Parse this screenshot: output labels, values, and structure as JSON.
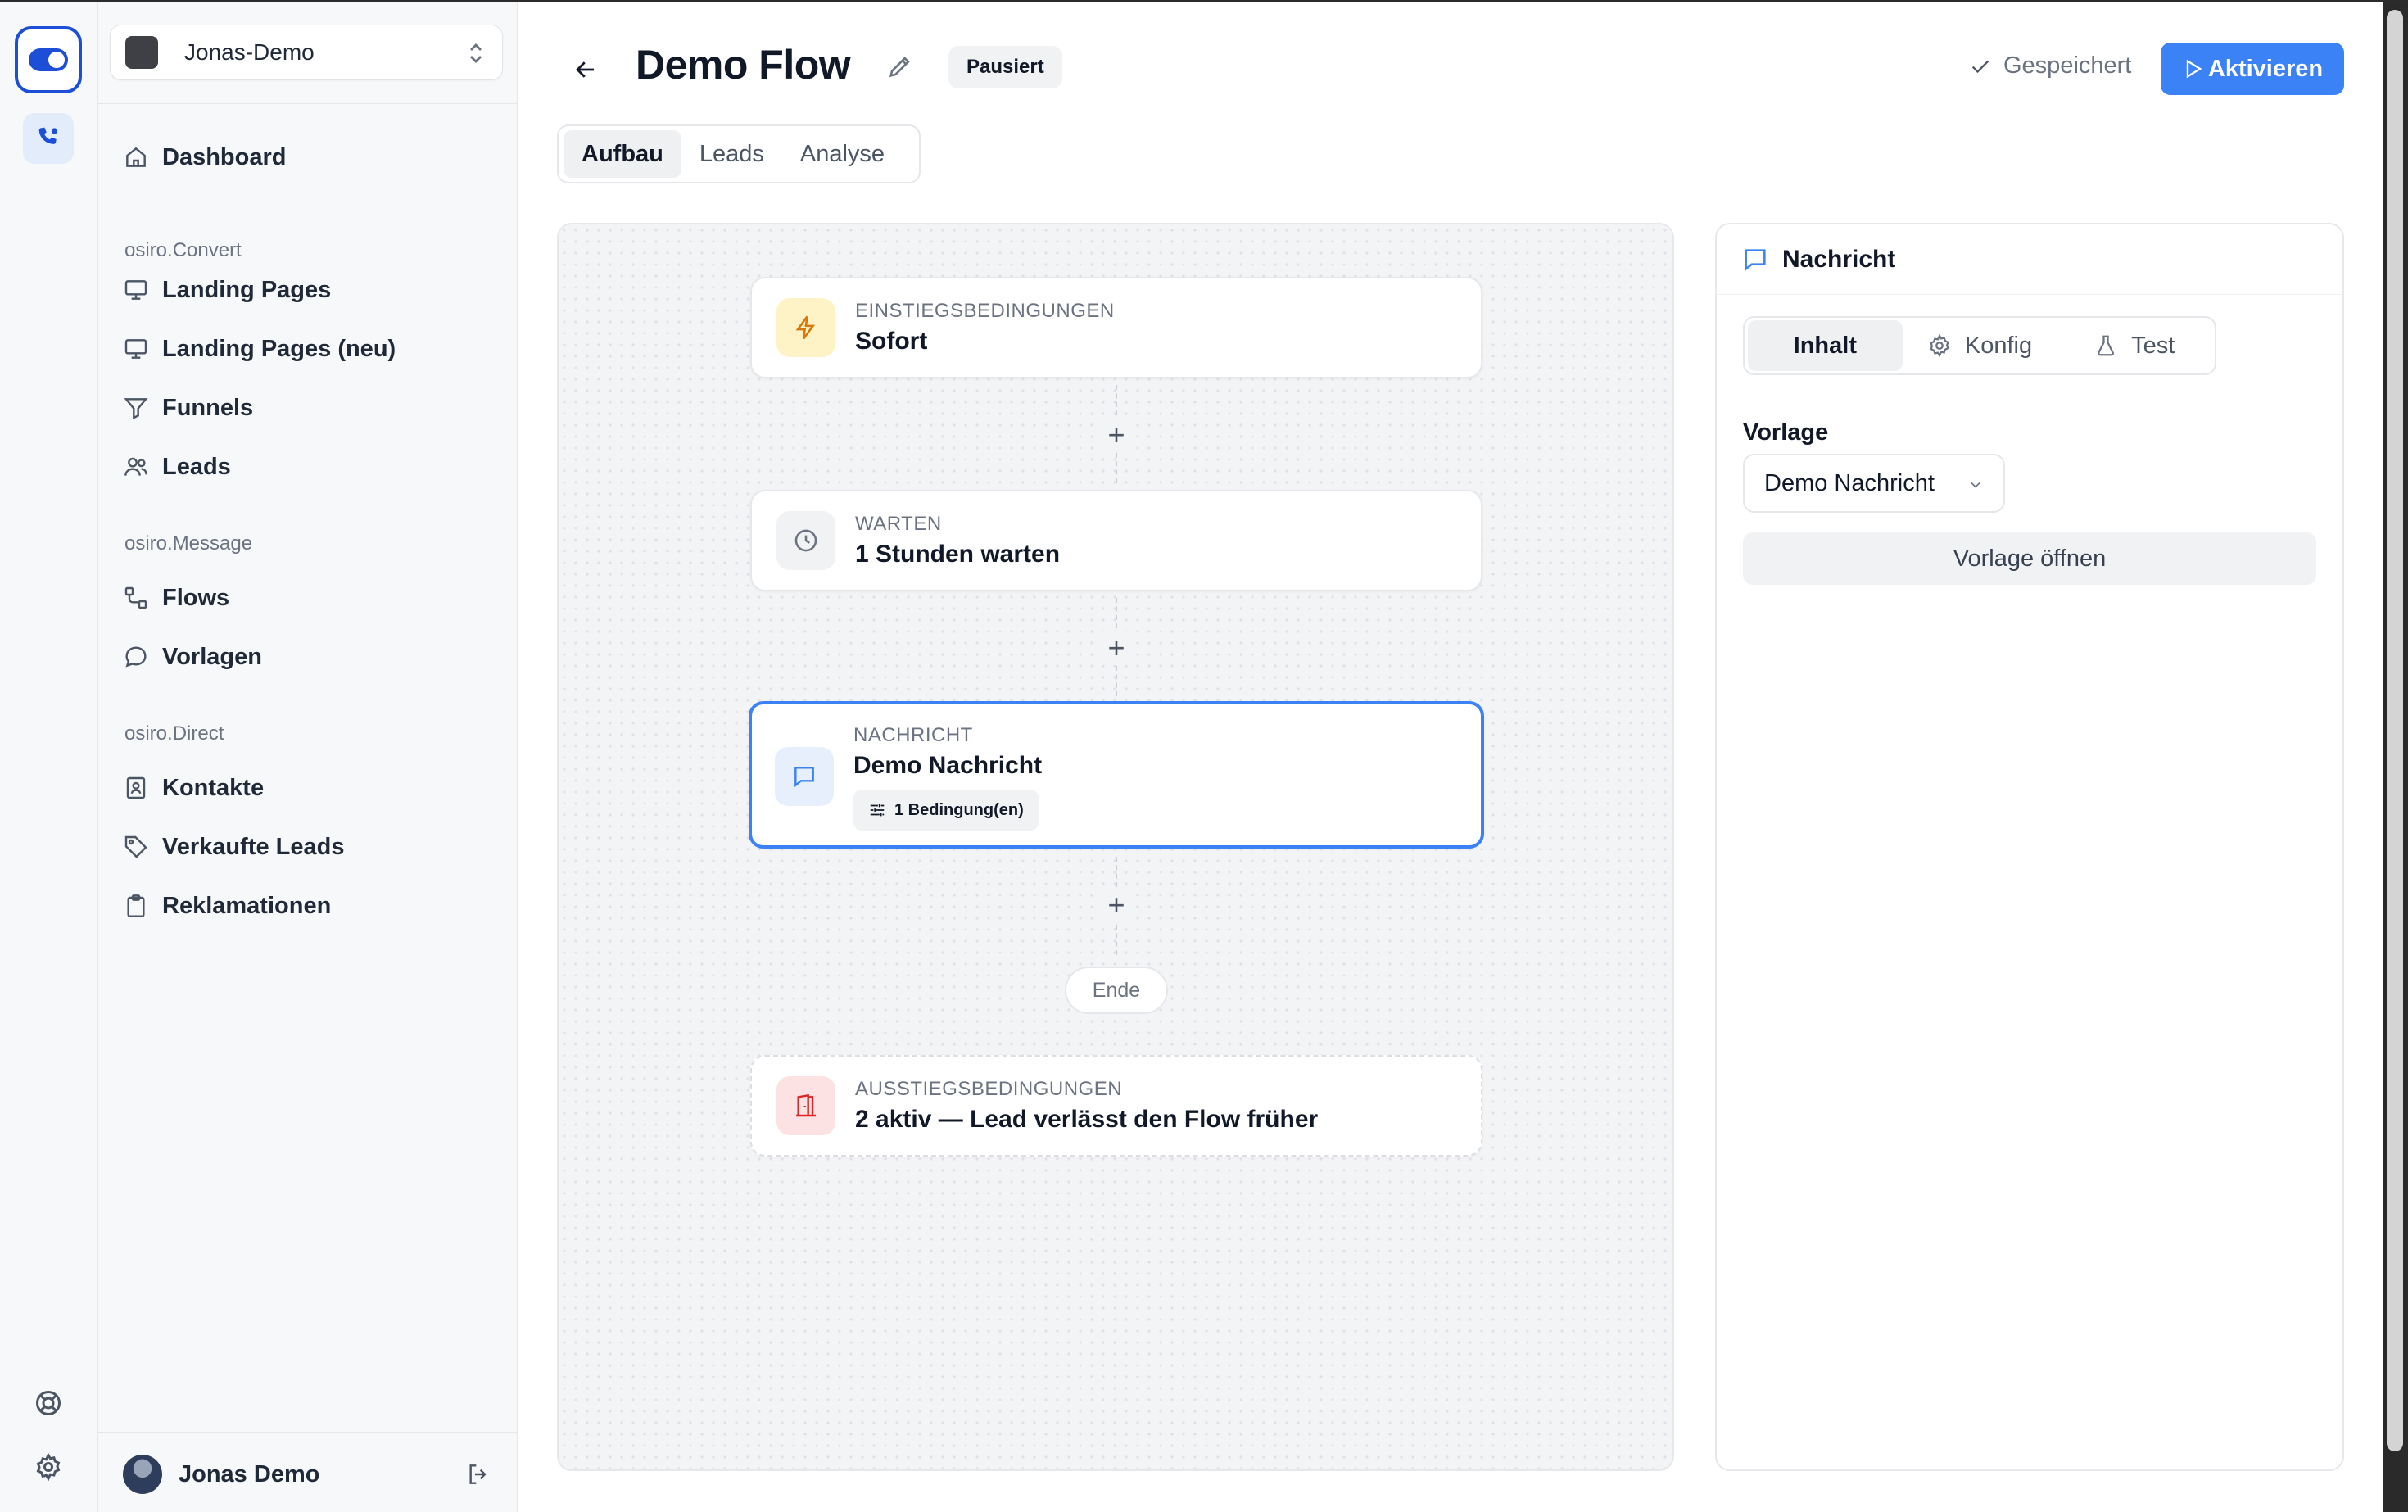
{
  "workspace": {
    "name": "Jonas-Demo"
  },
  "sidebar": {
    "items": [
      {
        "label": "Dashboard",
        "icon": "home-icon"
      }
    ],
    "sections": [
      {
        "title": "osiro.Convert",
        "items": [
          {
            "label": "Landing Pages",
            "icon": "monitor-icon"
          },
          {
            "label": "Landing Pages (neu)",
            "icon": "monitor-icon"
          },
          {
            "label": "Funnels",
            "icon": "filter-icon"
          },
          {
            "label": "Leads",
            "icon": "users-icon"
          }
        ]
      },
      {
        "title": "osiro.Message",
        "items": [
          {
            "label": "Flows",
            "icon": "flow-icon"
          },
          {
            "label": "Vorlagen",
            "icon": "chat-bubble-icon"
          }
        ]
      },
      {
        "title": "osiro.Direct",
        "items": [
          {
            "label": "Kontakte",
            "icon": "contact-book-icon"
          },
          {
            "label": "Verkaufte Leads",
            "icon": "tag-icon"
          },
          {
            "label": "Reklamationen",
            "icon": "clipboard-icon"
          }
        ]
      }
    ],
    "user": {
      "name": "Jonas Demo"
    }
  },
  "header": {
    "title": "Demo Flow",
    "status": "Pausiert",
    "saved_label": "Gespeichert",
    "activate_label": "Aktivieren"
  },
  "tabs": [
    {
      "label": "Aufbau",
      "active": true
    },
    {
      "label": "Leads",
      "active": false
    },
    {
      "label": "Analyse",
      "active": false
    }
  ],
  "flow": {
    "entry": {
      "label": "EINSTIEGSBEDINGUNGEN",
      "title": "Sofort"
    },
    "wait": {
      "label": "WARTEN",
      "title": "1 Stunden warten"
    },
    "message": {
      "label": "NACHRICHT",
      "title": "Demo Nachricht",
      "conditions": "1 Bedingung(en)"
    },
    "add_symbol": "+",
    "end_label": "Ende",
    "exit": {
      "label": "AUSSTIEGSBEDINGUNGEN",
      "title": "2 aktiv — Lead verlässt den Flow früher"
    }
  },
  "panel": {
    "title": "Nachricht",
    "tabs": [
      {
        "label": "Inhalt",
        "active": true
      },
      {
        "label": "Konfig",
        "active": false
      },
      {
        "label": "Test",
        "active": false
      }
    ],
    "template_label": "Vorlage",
    "template_value": "Demo Nachricht",
    "open_button": "Vorlage öffnen"
  },
  "colors": {
    "accent": "#3b82f6",
    "brand": "#1d4ed8",
    "entry_icon_bg": "#fef3c7",
    "exit_icon_bg": "#fde2e4"
  }
}
